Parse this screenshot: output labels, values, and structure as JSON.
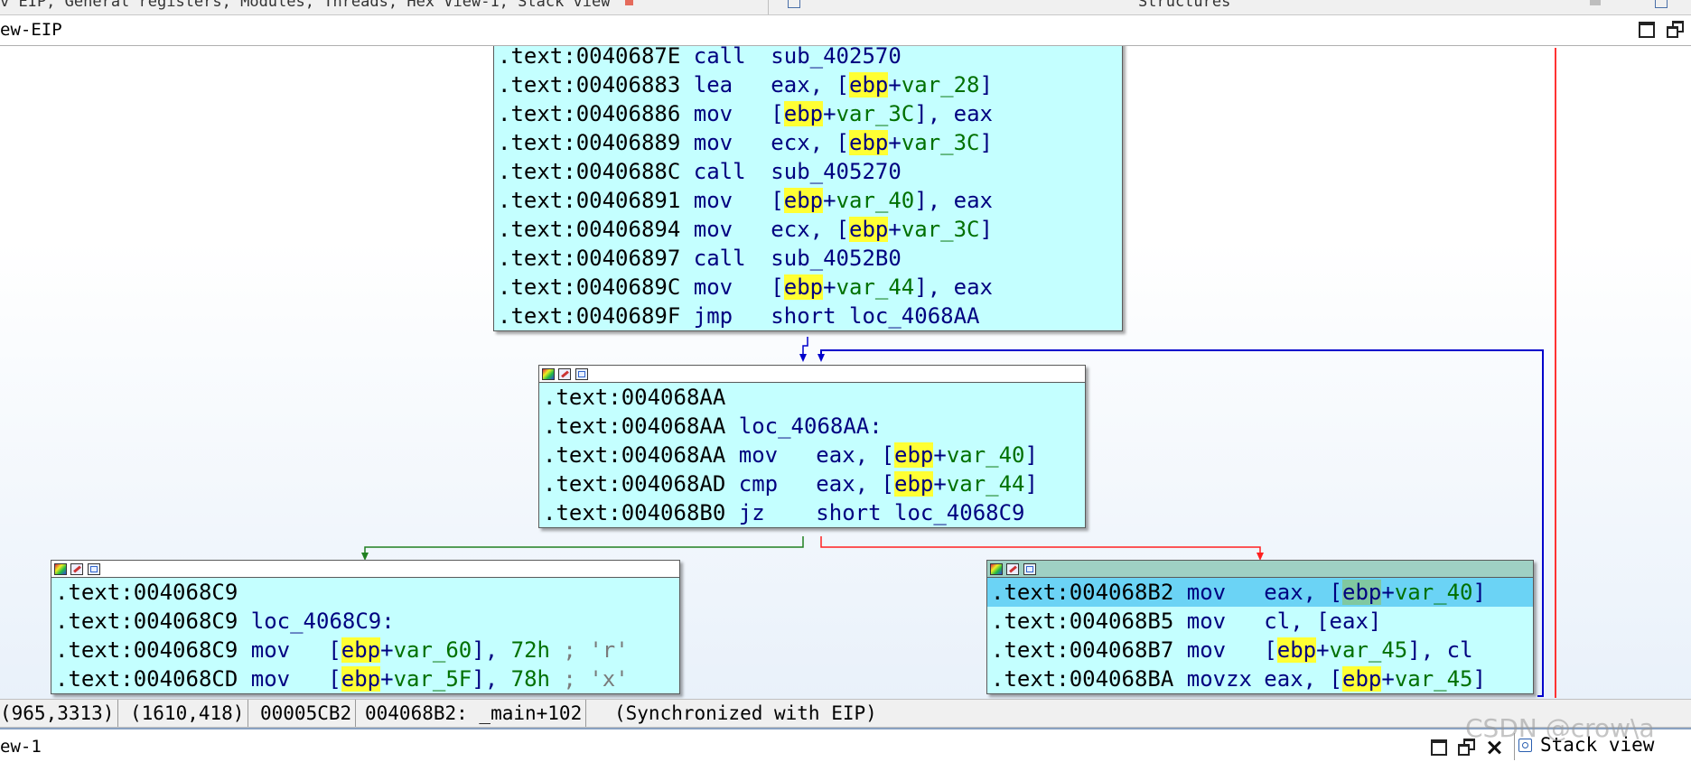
{
  "top_tabs": {
    "left_text": "v EIP, General registers, Modules, Threads, Hex View-1, Stack view",
    "right_text": "Structures"
  },
  "main_window": {
    "title": "ew-EIP"
  },
  "blocks": {
    "b1": {
      "lines": [
        {
          "addr": ".text:0040687E",
          "mn": "call",
          "op": [
            {
              "t": "sub_402570",
              "c": "lbl"
            }
          ]
        },
        {
          "addr": ".text:00406883",
          "mn": "lea",
          "op": [
            {
              "t": "eax, [",
              "c": "p"
            },
            {
              "t": "ebp",
              "c": "reg"
            },
            {
              "t": "+",
              "c": "p"
            },
            {
              "t": "var_28",
              "c": "var"
            },
            {
              "t": "]",
              "c": "p"
            }
          ]
        },
        {
          "addr": ".text:00406886",
          "mn": "mov",
          "op": [
            {
              "t": "[",
              "c": "p"
            },
            {
              "t": "ebp",
              "c": "reg"
            },
            {
              "t": "+",
              "c": "p"
            },
            {
              "t": "var_3C",
              "c": "var"
            },
            {
              "t": "], eax",
              "c": "p"
            }
          ]
        },
        {
          "addr": ".text:00406889",
          "mn": "mov",
          "op": [
            {
              "t": "ecx, [",
              "c": "p"
            },
            {
              "t": "ebp",
              "c": "reg"
            },
            {
              "t": "+",
              "c": "p"
            },
            {
              "t": "var_3C",
              "c": "var"
            },
            {
              "t": "]",
              "c": "p"
            }
          ]
        },
        {
          "addr": ".text:0040688C",
          "mn": "call",
          "op": [
            {
              "t": "sub_405270",
              "c": "lbl"
            }
          ]
        },
        {
          "addr": ".text:00406891",
          "mn": "mov",
          "op": [
            {
              "t": "[",
              "c": "p"
            },
            {
              "t": "ebp",
              "c": "reg"
            },
            {
              "t": "+",
              "c": "p"
            },
            {
              "t": "var_40",
              "c": "var"
            },
            {
              "t": "], eax",
              "c": "p"
            }
          ]
        },
        {
          "addr": ".text:00406894",
          "mn": "mov",
          "op": [
            {
              "t": "ecx, [",
              "c": "p"
            },
            {
              "t": "ebp",
              "c": "reg"
            },
            {
              "t": "+",
              "c": "p"
            },
            {
              "t": "var_3C",
              "c": "var"
            },
            {
              "t": "]",
              "c": "p"
            }
          ]
        },
        {
          "addr": ".text:00406897",
          "mn": "call",
          "op": [
            {
              "t": "sub_4052B0",
              "c": "lbl"
            }
          ]
        },
        {
          "addr": ".text:0040689C",
          "mn": "mov",
          "op": [
            {
              "t": "[",
              "c": "p"
            },
            {
              "t": "ebp",
              "c": "reg"
            },
            {
              "t": "+",
              "c": "p"
            },
            {
              "t": "var_44",
              "c": "var"
            },
            {
              "t": "], eax",
              "c": "p"
            }
          ]
        },
        {
          "addr": ".text:0040689F",
          "mn": "jmp",
          "op": [
            {
              "t": "short loc_4068AA",
              "c": "lbl"
            }
          ]
        }
      ]
    },
    "b2": {
      "lines": [
        {
          "addr": ".text:004068AA",
          "mn": "",
          "op": []
        },
        {
          "addr": ".text:004068AA",
          "mn": "",
          "label": "loc_4068AA:",
          "op": []
        },
        {
          "addr": ".text:004068AA",
          "mn": "mov",
          "op": [
            {
              "t": "eax, [",
              "c": "p"
            },
            {
              "t": "ebp",
              "c": "reg"
            },
            {
              "t": "+",
              "c": "p"
            },
            {
              "t": "var_40",
              "c": "var"
            },
            {
              "t": "]",
              "c": "p"
            }
          ]
        },
        {
          "addr": ".text:004068AD",
          "mn": "cmp",
          "op": [
            {
              "t": "eax, [",
              "c": "p"
            },
            {
              "t": "ebp",
              "c": "reg"
            },
            {
              "t": "+",
              "c": "p"
            },
            {
              "t": "var_44",
              "c": "var"
            },
            {
              "t": "]",
              "c": "p"
            }
          ]
        },
        {
          "addr": ".text:004068B0",
          "mn": "jz",
          "op": [
            {
              "t": "short loc_4068C9",
              "c": "lbl"
            }
          ]
        }
      ]
    },
    "b3": {
      "lines": [
        {
          "addr": ".text:004068C9",
          "mn": "",
          "op": []
        },
        {
          "addr": ".text:004068C9",
          "mn": "",
          "label": "loc_4068C9:",
          "op": []
        },
        {
          "addr": ".text:004068C9",
          "mn": "mov",
          "op": [
            {
              "t": "[",
              "c": "p"
            },
            {
              "t": "ebp",
              "c": "reg"
            },
            {
              "t": "+",
              "c": "p"
            },
            {
              "t": "var_60",
              "c": "var"
            },
            {
              "t": "], ",
              "c": "p"
            },
            {
              "t": "72h",
              "c": "num"
            },
            {
              "t": " ; 'r'",
              "c": "cmt"
            }
          ]
        },
        {
          "addr": ".text:004068CD",
          "mn": "mov",
          "op": [
            {
              "t": "[",
              "c": "p"
            },
            {
              "t": "ebp",
              "c": "reg"
            },
            {
              "t": "+",
              "c": "p"
            },
            {
              "t": "var_5F",
              "c": "var"
            },
            {
              "t": "], ",
              "c": "p"
            },
            {
              "t": "78h",
              "c": "num"
            },
            {
              "t": " ; 'x'",
              "c": "cmt"
            }
          ]
        }
      ]
    },
    "b4": {
      "lines": [
        {
          "addr": ".text:004068B2",
          "mn": "mov",
          "hl": true,
          "op": [
            {
              "t": "eax, [",
              "c": "p"
            },
            {
              "t": "ebp",
              "c": "reg green"
            },
            {
              "t": "+",
              "c": "p"
            },
            {
              "t": "var_40",
              "c": "var"
            },
            {
              "t": "]",
              "c": "p"
            }
          ]
        },
        {
          "addr": ".text:004068B5",
          "mn": "mov",
          "op": [
            {
              "t": "cl, [eax]",
              "c": "p"
            }
          ]
        },
        {
          "addr": ".text:004068B7",
          "mn": "mov",
          "op": [
            {
              "t": "[",
              "c": "p"
            },
            {
              "t": "ebp",
              "c": "reg"
            },
            {
              "t": "+",
              "c": "p"
            },
            {
              "t": "var_45",
              "c": "var"
            },
            {
              "t": "], cl",
              "c": "p"
            }
          ]
        },
        {
          "addr": ".text:004068BA",
          "mn": "movzx",
          "op": [
            {
              "t": "eax, [",
              "c": "p"
            },
            {
              "t": "ebp",
              "c": "reg"
            },
            {
              "t": "+",
              "c": "p"
            },
            {
              "t": "var_45",
              "c": "var"
            },
            {
              "t": "]",
              "c": "p"
            }
          ]
        }
      ]
    }
  },
  "status_bar": {
    "zoom": "(965,3313)",
    "coords": "(1610,418)",
    "offset": "00005CB2",
    "location": "004068B2: _main+102",
    "sync": "(Synchronized with EIP)"
  },
  "bottom_window": {
    "title": "ew-1",
    "stack_tab_label": "Stack view"
  },
  "watermark": "CSDN @crow\\a",
  "colors": {
    "block_bg": "#c4ffff",
    "highlight_line": "#6bd3f5",
    "register_highlight": "#ffff33",
    "edge_true": "#208020",
    "edge_false": "#ff2020",
    "edge_jump": "#0000cc"
  }
}
